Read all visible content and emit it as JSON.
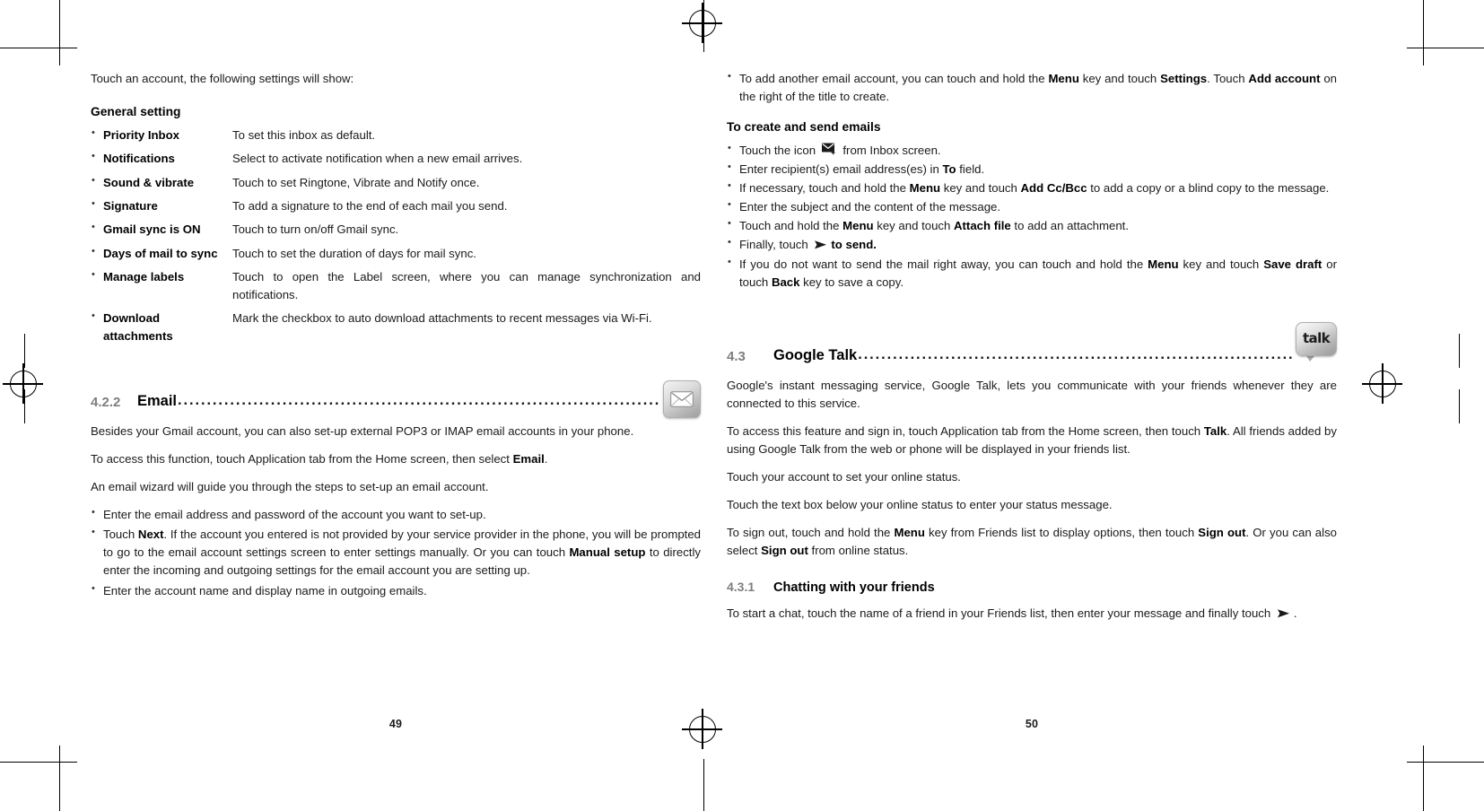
{
  "document": {
    "type": "mobile-phone-user-manual",
    "left_page_number": "49",
    "right_page_number": "50"
  },
  "left_page": {
    "intro": "Touch an account, the following settings will show:",
    "general_setting_heading": "General setting",
    "settings_table": [
      {
        "term": "Priority Inbox",
        "definition": "To set this inbox as default."
      },
      {
        "term": "Notifications",
        "definition": "Select to activate notification when a new email arrives."
      },
      {
        "term": "Sound & vibrate",
        "definition": "Touch to set Ringtone, Vibrate and Notify once."
      },
      {
        "term": "Signature",
        "definition": "To add a signature to the end of each mail you send."
      },
      {
        "term": "Gmail sync is ON",
        "definition": "Touch to turn on/off Gmail sync."
      },
      {
        "term": "Days of mail to sync",
        "definition": "Touch to set the duration of days for mail sync."
      },
      {
        "term": "Manage labels",
        "definition": "Touch to open the Label screen, where you can manage synchronization and notifications."
      },
      {
        "term": "Download attachments",
        "definition": "Mark the checkbox to auto download attachments to recent messages via Wi-Fi."
      }
    ],
    "section_email": {
      "number": "4.2.2",
      "title": "Email",
      "leader": "..............................................................................................",
      "icon": "mail-icon"
    },
    "paragraphs": [
      "Besides your Gmail account, you can also set-up external POP3 or IMAP email accounts in your phone.",
      "To access this function, touch Application tab from the Home screen, then select Email.",
      "An email wizard will guide you through the steps to set-up an email account."
    ],
    "para2_prefix": "To access this function, touch Application tab from the Home screen, then select ",
    "para2_bold": "Email",
    "para2_suffix": ".",
    "bullets": [
      "Enter the email address and password of the account you want to set-up.",
      "Enter the account name and display name in outgoing emails."
    ],
    "bullet_next": {
      "p1": "Touch ",
      "b1": "Next",
      "p2": ". If the account you entered is not provided by your service provider in the phone, you will be prompted to go to the email account settings screen to enter settings manually. Or you can touch ",
      "b2": "Manual setup",
      "p3": " to directly enter the incoming and outgoing settings for the email account you are setting up."
    }
  },
  "right_page": {
    "bullet_add_account": {
      "p1": "To add another email account, you can touch and hold the ",
      "b1": "Menu",
      "p2": " key and touch ",
      "b2": "Settings",
      "p3": ". Touch ",
      "b3": "Add account",
      "p4": " on the right of the title to create."
    },
    "create_send_heading": "To create and send emails",
    "create_send_bullets": [
      {
        "p1": "Touch the icon ",
        "icon": "compose-mail-icon",
        "p2": " from Inbox screen."
      },
      {
        "p1": "Enter recipient(s) email address(es) in ",
        "b1": "To",
        "p2": " field."
      },
      {
        "p1": "If necessary, touch and hold the ",
        "b1": "Menu",
        "p2": " key and touch ",
        "b2": "Add Cc/Bcc",
        "p3": " to add a copy or a blind copy to the message."
      },
      {
        "p1": "Enter the subject and the content of the message.",
        "b1": "",
        "p2": ""
      },
      {
        "p1": "Touch and hold the ",
        "b1": "Menu",
        "p2": " key and touch ",
        "b2": "Attach file",
        "p3": " to add an attachment."
      },
      {
        "p1": "Finally, touch ",
        "icon": "send-icon",
        "b1": "to send.",
        "p2": ""
      },
      {
        "p1": "If you do not want to send the mail right away, you can touch and hold the ",
        "b1": "Menu",
        "p2": " key and touch ",
        "b2": "Save draft",
        "p3": " or touch ",
        "b3": "Back",
        "p4": " key to save a copy."
      }
    ],
    "section_talk": {
      "number": "4.3",
      "title": "Google Talk",
      "leader": "..................................................................................",
      "icon": "google-talk-icon",
      "icon_label": "talk"
    },
    "talk_paragraphs": [
      "Google's instant messaging service, Google Talk, lets you communicate with your friends whenever they are connected to this service.",
      "Touch your account to set your online status.",
      "Touch the text box below your online status to enter your status message."
    ],
    "talk_access": {
      "p1": "To access this feature and sign in, touch Application tab from the Home screen, then touch ",
      "b1": "Talk",
      "p2": ". All friends added by using Google Talk from the web or phone will be displayed in your friends list."
    },
    "talk_signout": {
      "p1": "To sign out, touch and hold the ",
      "b1": "Menu",
      "p2": " key from Friends list to display options, then touch ",
      "b2": "Sign out",
      "p3": ". Or you can also select ",
      "b3": "Sign out",
      "p4": " from online status."
    },
    "subsection_chatting": {
      "number": "4.3.1",
      "title": "Chatting with your friends"
    },
    "chatting_text": {
      "p1": "To start a chat, touch the name of a friend in your Friends list, then enter your message and finally touch ",
      "icon": "send-icon",
      "p2": "."
    }
  }
}
